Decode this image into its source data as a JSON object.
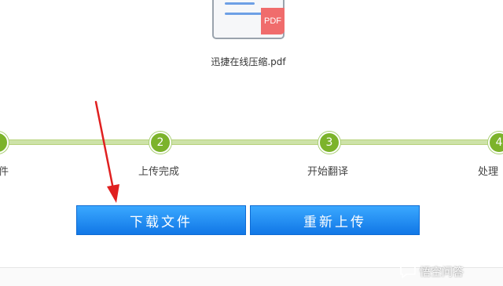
{
  "file": {
    "badge": "PDF",
    "name": "迅捷在线压缩.pdf"
  },
  "steps": [
    {
      "number": "",
      "label": "件"
    },
    {
      "number": "2",
      "label": "上传完成"
    },
    {
      "number": "3",
      "label": "开始翻译"
    },
    {
      "number": "4",
      "label": "处理"
    }
  ],
  "buttons": {
    "download": "下载文件",
    "reupload": "重新上传"
  },
  "colors": {
    "button_blue": "#1a8cf0",
    "step_green": "#7cb32b",
    "arrow_red": "#e02020",
    "pdf_red": "#f06c6c"
  },
  "watermark": {
    "text": "悟空问答"
  }
}
